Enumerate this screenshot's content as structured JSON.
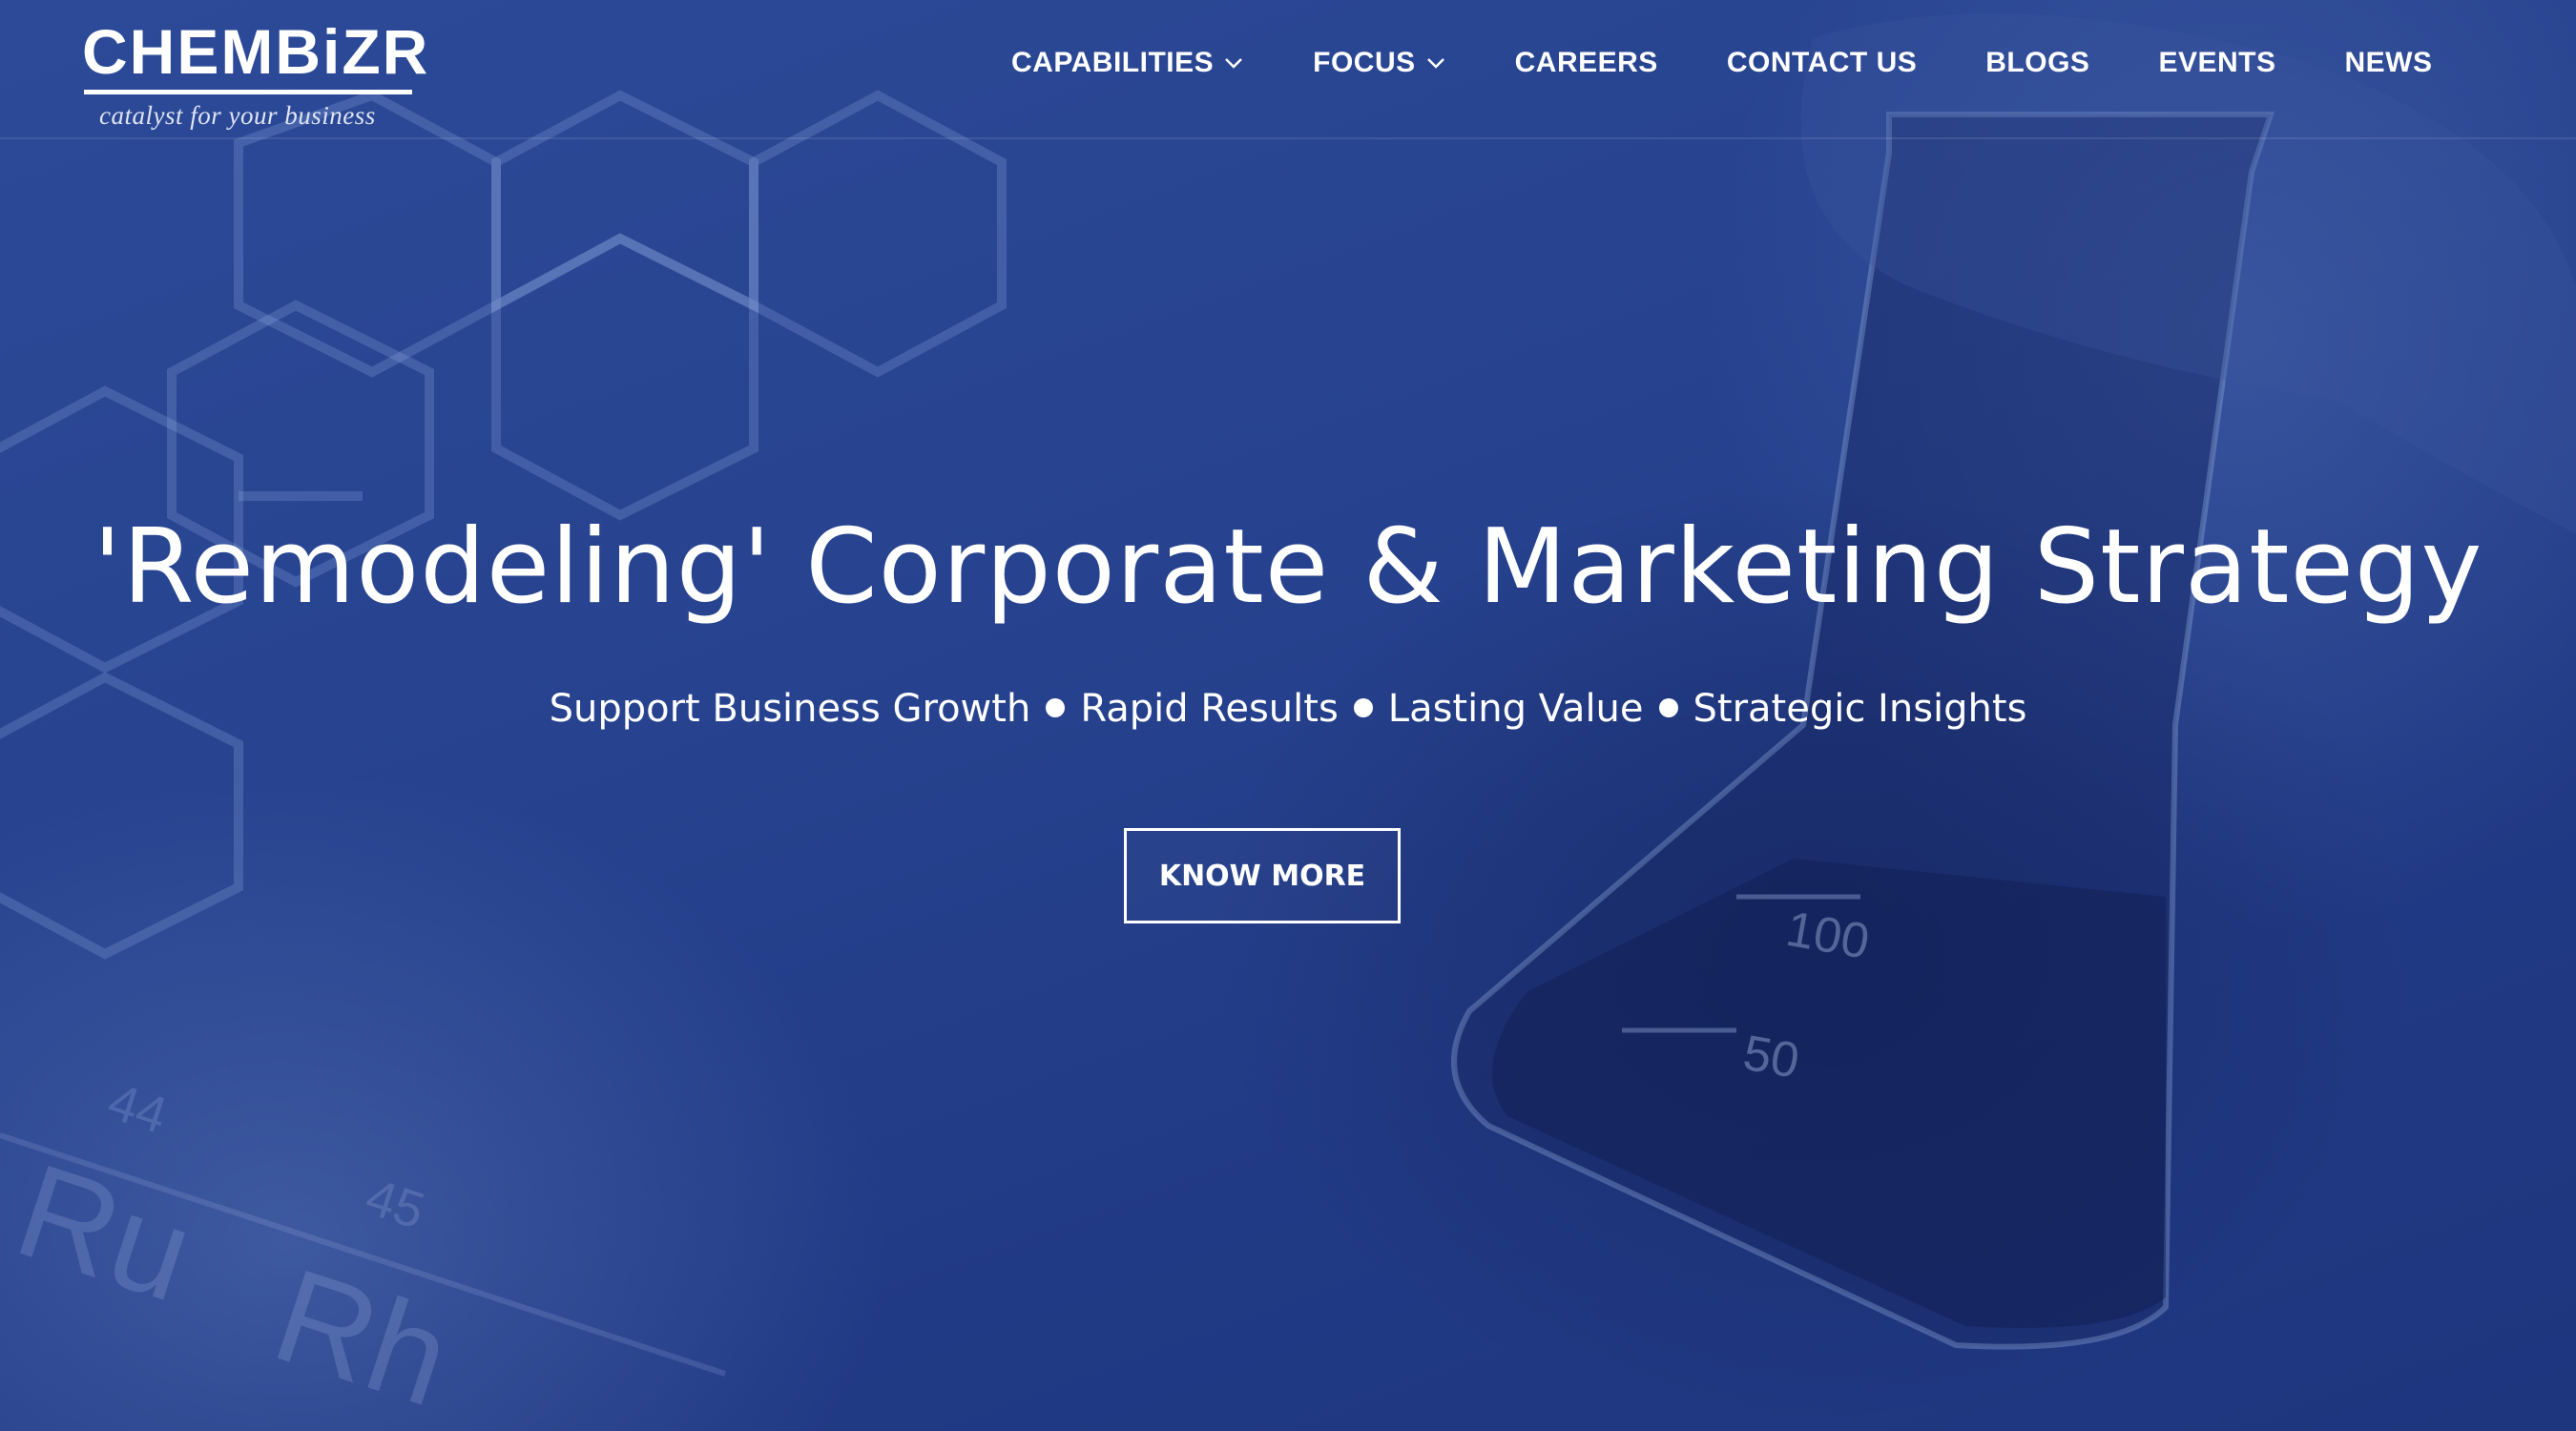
{
  "brand": {
    "name": "CHEMBiZR",
    "tagline": "catalyst for your business",
    "background_color": "#263f8a",
    "text_color": "#ffffff"
  },
  "nav": {
    "items": [
      {
        "label": "CAPABILITIES",
        "has_dropdown": true
      },
      {
        "label": "FOCUS",
        "has_dropdown": true
      },
      {
        "label": "CAREERS",
        "has_dropdown": false
      },
      {
        "label": "CONTACT US",
        "has_dropdown": false
      },
      {
        "label": "BLOGS",
        "has_dropdown": false
      },
      {
        "label": "EVENTS",
        "has_dropdown": false
      },
      {
        "label": "NEWS",
        "has_dropdown": false
      }
    ]
  },
  "hero": {
    "title": "'Remodeling' Corporate & Marketing Strategy",
    "highlights": [
      "Support Business Growth",
      "Rapid Results",
      "Lasting Value",
      "Strategic Insights"
    ],
    "cta_label": "KNOW MORE"
  },
  "background": {
    "icons": [
      "hexagon-molecule-icon",
      "lab-flask-icon",
      "periodic-table-icon"
    ],
    "flask_markings": [
      "100",
      "50"
    ],
    "periodic_fragments": [
      "Ru",
      "Rh",
      "45",
      "44"
    ]
  }
}
